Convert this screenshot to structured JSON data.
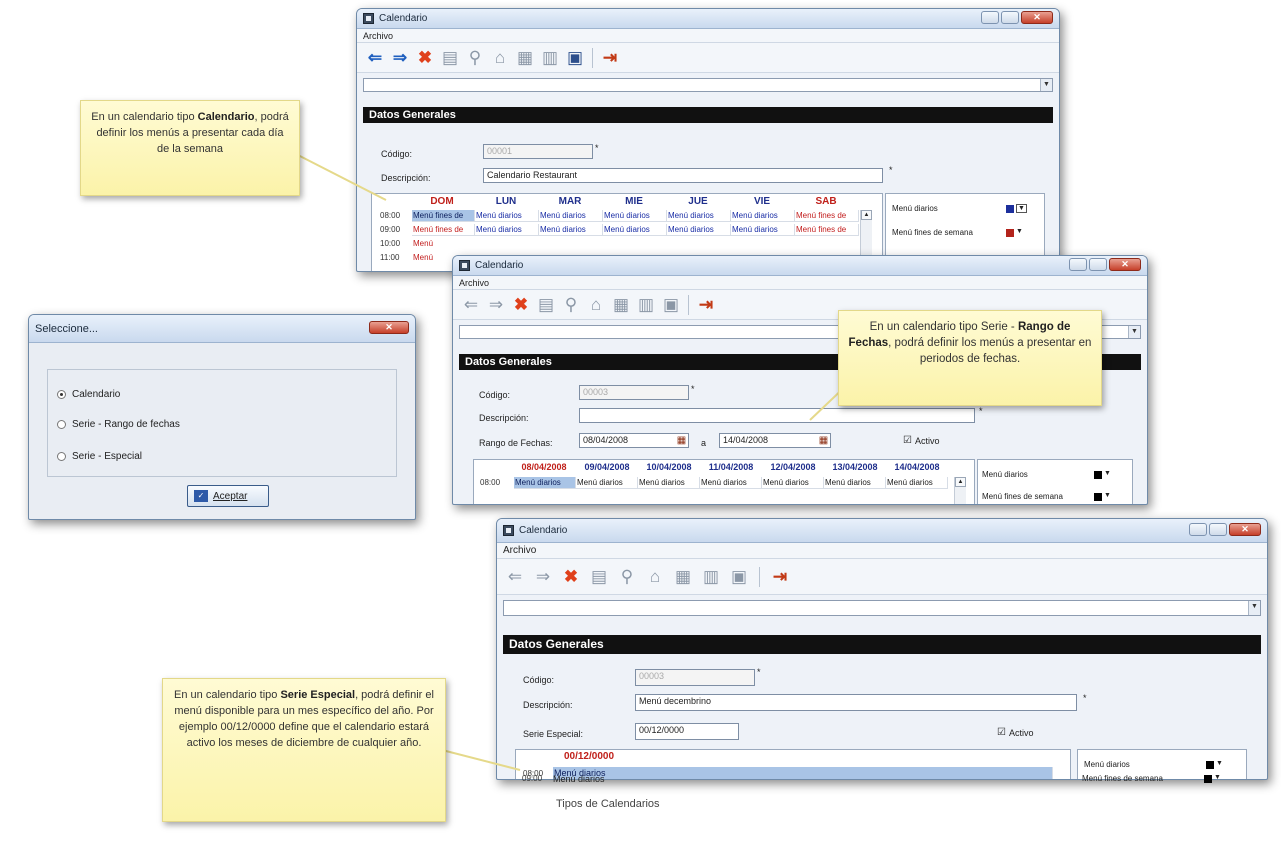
{
  "caption": "Tipos de Calendarios",
  "windows": {
    "w1": {
      "title": "Calendario",
      "menu": "Archivo",
      "section": "Datos Generales",
      "codigo_label": "Código:",
      "codigo_value": "00001",
      "descripcion_label": "Descripción:",
      "descripcion_value": "Calendario Restaurant",
      "days": [
        "DOM",
        "LUN",
        "MAR",
        "MIE",
        "JUE",
        "VIE",
        "SAB"
      ],
      "rows": [
        {
          "time": "08:00",
          "cells": [
            "Menú fines de",
            "Menú diarios",
            "Menú diarios",
            "Menú diarios",
            "Menú diarios",
            "Menú diarios",
            "Menú fines de"
          ]
        },
        {
          "time": "09:00",
          "cells": [
            "Menú fines de",
            "Menú diarios",
            "Menú diarios",
            "Menú diarios",
            "Menú diarios",
            "Menú diarios",
            "Menú fines de"
          ]
        },
        {
          "time": "10:00",
          "cells": [
            "Menú"
          ]
        },
        {
          "time": "11:00",
          "cells": [
            "Menú"
          ]
        }
      ],
      "legend": [
        "Menú diarios",
        "Menú fines de semana"
      ]
    },
    "w2": {
      "title": "Calendario",
      "menu": "Archivo",
      "section": "Datos Generales",
      "codigo_label": "Código:",
      "codigo_value": "00003",
      "descripcion_label": "Descripción:",
      "rango_label": "Rango de Fechas:",
      "fecha_desde": "08/04/2008",
      "a_label": "a",
      "fecha_hasta": "14/04/2008",
      "activo_label": "Activo",
      "days": [
        "08/04/2008",
        "09/04/2008",
        "10/04/2008",
        "11/04/2008",
        "12/04/2008",
        "13/04/2008",
        "14/04/2008"
      ],
      "row": {
        "time": "08:00",
        "cells": [
          "Menú diarios",
          "Menú diarios",
          "Menú diarios",
          "Menú diarios",
          "Menú diarios",
          "Menú diarios",
          "Menú diarios"
        ]
      },
      "legend": [
        "Menú diarios",
        "Menú fines de semana"
      ]
    },
    "w3": {
      "title": "Calendario",
      "menu": "Archivo",
      "section": "Datos Generales",
      "codigo_label": "Código:",
      "codigo_value": "00003",
      "descripcion_label": "Descripción:",
      "descripcion_value": "Menú decembrino",
      "serie_label": "Serie Especial:",
      "serie_value": "00/12/0000",
      "activo_label": "Activo",
      "day": "00/12/0000",
      "rows": [
        {
          "time": "08:00",
          "cell": "Menú diarios"
        },
        {
          "time": "09:00",
          "cell": "Menú diarios"
        }
      ],
      "legend": [
        "Menú diarios",
        "Menú fines de semana"
      ]
    }
  },
  "dialog": {
    "title": "Seleccione...",
    "options": [
      "Calendario",
      "Serie - Rango de fechas",
      "Serie - Especial"
    ],
    "selected": "Calendario",
    "ok_label": "Aceptar"
  },
  "callouts": {
    "c1": {
      "pre": "En un calendario tipo",
      "bold": "Calendario",
      "post": ", podrá definir los menús a presentar cada día de la semana"
    },
    "c2": {
      "pre": "En un calendario tipo Serie -",
      "bold": "Rango de Fechas",
      "post": ", podrá definir los menús a presentar en periodos de fechas."
    },
    "c3": {
      "pre": "En un calendario tipo",
      "bold": "Serie Especial",
      "post": ", podrá definir el menú disponible para un mes específico del año. Por ejemplo 00/12/0000 define que el calendario estará activo los meses de diciembre de cualquier año."
    }
  },
  "colors": {
    "menu_diarios": "#1a2ea6",
    "menu_fines": "#c21d1d",
    "legend_w1_diarios": "#1c2f9c",
    "legend_w1_fines": "#b3231b",
    "legend_black": "#000000"
  }
}
